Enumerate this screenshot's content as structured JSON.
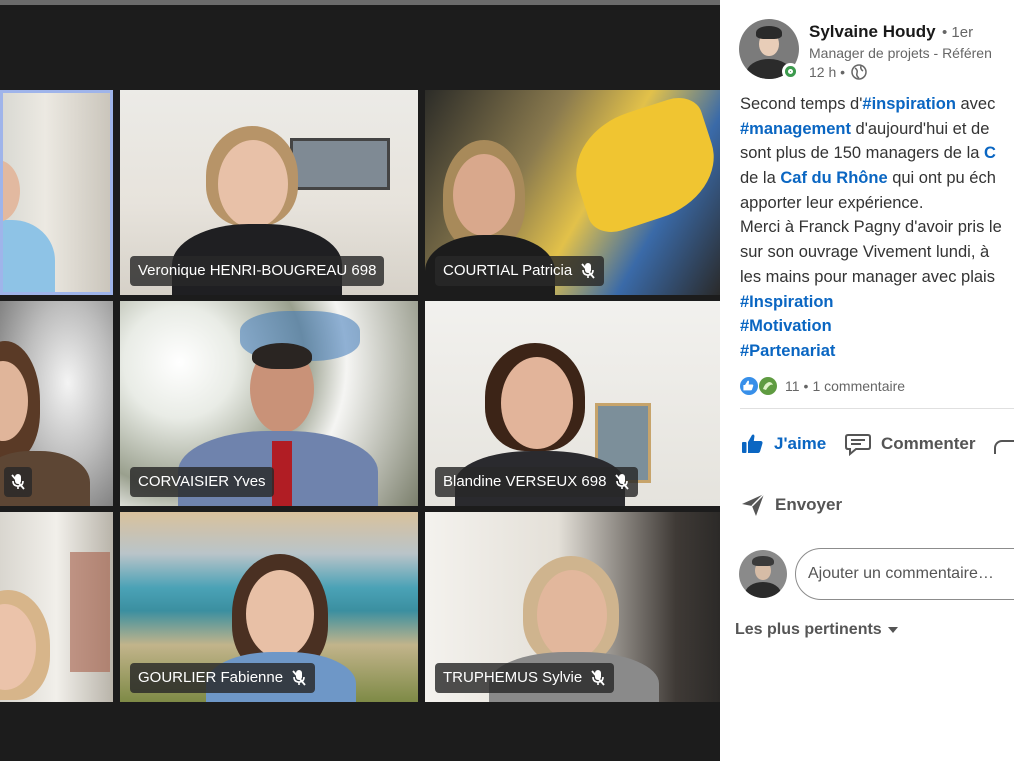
{
  "meeting": {
    "participants": [
      {
        "name": "",
        "muted": false,
        "active_speaker": true
      },
      {
        "name": "Veronique HENRI-BOUGREAU 698",
        "muted": false
      },
      {
        "name": "COURTIAL Patricia",
        "muted": true
      },
      {
        "name": "",
        "muted": true
      },
      {
        "name": "CORVAISIER Yves",
        "muted": false
      },
      {
        "name": "Blandine VERSEUX 698",
        "muted": true
      },
      {
        "name": "",
        "muted": false
      },
      {
        "name": "GOURLIER Fabienne",
        "muted": true
      },
      {
        "name": "TRUPHEMUS Sylvie",
        "muted": true
      }
    ]
  },
  "post": {
    "author": {
      "name": "Sylvaine Houdy",
      "degree": "• 1er",
      "headline": "Manager de projets - Référen",
      "time": "12 h •",
      "online": true
    },
    "lines": [
      {
        "a": "Second temps d'",
        "b": "#inspiration",
        "c": " avec"
      },
      {
        "a": "",
        "b": "#management",
        "c": " d'aujourd'hui et de"
      },
      {
        "a": "sont plus de 150 managers de la ",
        "b": "C",
        "c": ""
      },
      {
        "a": "de la ",
        "b": "Caf du Rhône",
        "c": " qui ont pu éch"
      },
      {
        "a": "apporter leur expérience.",
        "b": "",
        "c": ""
      },
      {
        "a": "Merci à Franck Pagny d'avoir pris le",
        "b": "",
        "c": ""
      },
      {
        "a": "sur son ouvrage Vivement lundi, à",
        "b": "",
        "c": ""
      },
      {
        "a": "les mains pour manager avec plais",
        "b": "",
        "c": ""
      },
      {
        "a": "",
        "b": "#Inspiration",
        "c": ""
      },
      {
        "a": "",
        "b": "#Motivation",
        "c": ""
      },
      {
        "a": "",
        "b": "#Partenariat",
        "c": ""
      }
    ],
    "reactions": {
      "count": "11",
      "separator": "•",
      "comments": "1 commentaire"
    },
    "actions": {
      "like": "J'aime",
      "comment": "Commenter",
      "send": "Envoyer"
    },
    "comment_placeholder": "Ajouter un commentaire…",
    "sort_label": "Les plus pertinents",
    "colors": {
      "link": "#0a66c2",
      "online": "#3c9a4d"
    }
  }
}
